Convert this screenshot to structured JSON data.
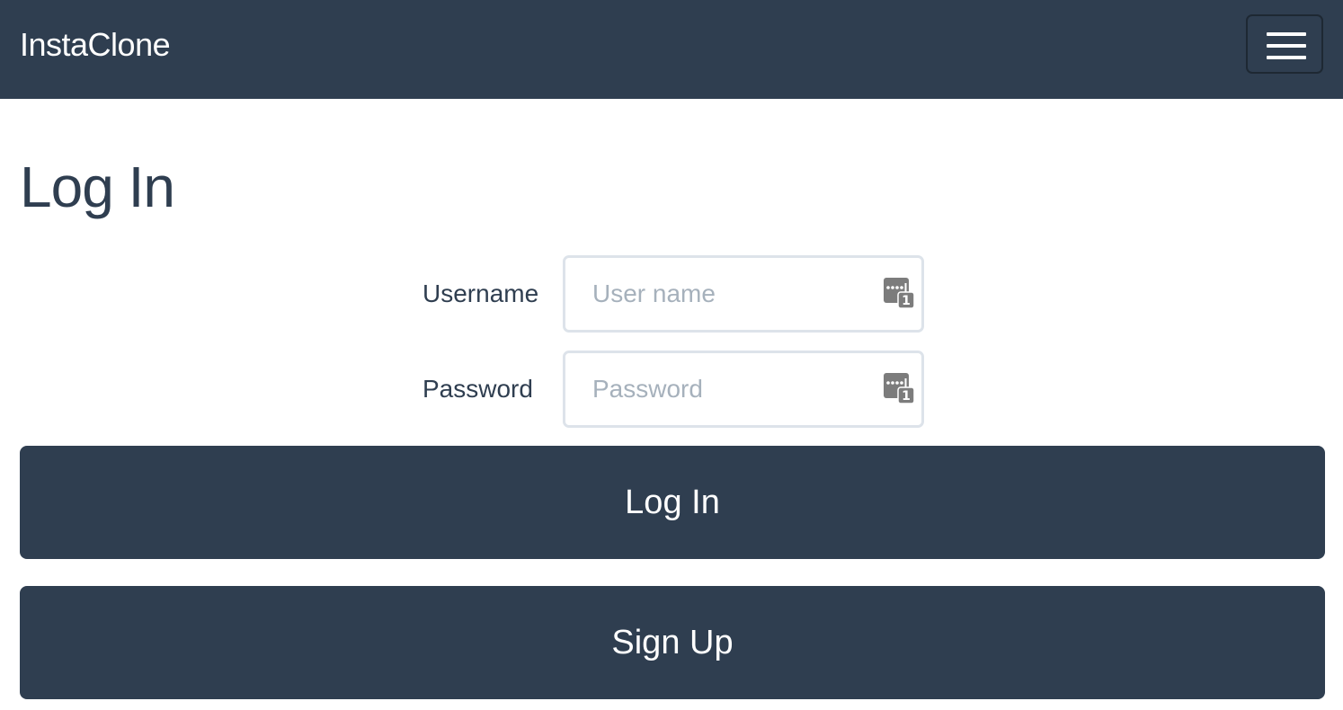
{
  "navbar": {
    "brand": "InstaClone",
    "menu_icon": "hamburger-menu-icon",
    "background": "#2f3e50"
  },
  "page": {
    "title": "Log In"
  },
  "form": {
    "username": {
      "label": "Username",
      "placeholder": "User name",
      "value": "",
      "icon": "password-manager-key-icon"
    },
    "password": {
      "label": "Password",
      "placeholder": "Password",
      "value": "",
      "icon": "password-manager-key-icon"
    }
  },
  "buttons": {
    "login_label": "Log In",
    "signup_label": "Sign Up"
  },
  "colors": {
    "primary": "#2f3e50",
    "input_border": "#dde3ea",
    "placeholder": "#a6b1bc"
  }
}
